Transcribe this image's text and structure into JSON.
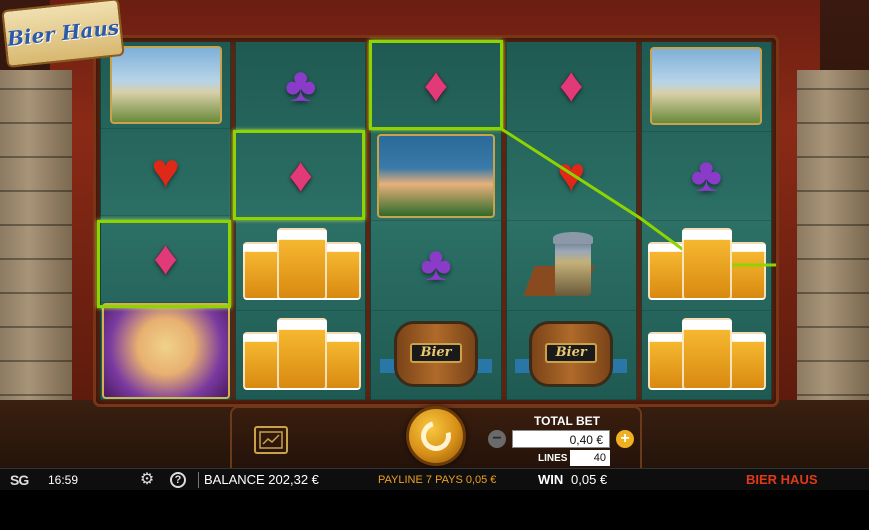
{
  "game": {
    "logo_text": "Bier Haus",
    "title": "BIER HAUS"
  },
  "reels": [
    [
      {
        "symbol": "castle",
        "icon": "castle-picture"
      },
      {
        "symbol": "heart",
        "glyph": "♥"
      },
      {
        "symbol": "diamond",
        "glyph": "♦",
        "winning": true
      },
      {
        "symbol": "woman",
        "icon": "barmaid-picture"
      }
    ],
    [
      {
        "symbol": "club",
        "glyph": "♣"
      },
      {
        "symbol": "diamond",
        "glyph": "♦",
        "winning": true
      },
      {
        "symbol": "beer",
        "icon": "beer-mugs-picture"
      },
      {
        "symbol": "beer",
        "icon": "beer-mugs-picture"
      }
    ],
    [
      {
        "symbol": "diamond",
        "glyph": "♦",
        "winning": true
      },
      {
        "symbol": "man",
        "icon": "bavarian-man-picture"
      },
      {
        "symbol": "club",
        "glyph": "♣"
      },
      {
        "symbol": "barrel",
        "icon": "bier-barrel-picture",
        "label": "Bier"
      }
    ],
    [
      {
        "symbol": "diamond",
        "glyph": "♦"
      },
      {
        "symbol": "heart",
        "glyph": "♥"
      },
      {
        "symbol": "stein",
        "icon": "beer-stein-picture"
      },
      {
        "symbol": "barrel",
        "icon": "bier-barrel-picture",
        "label": "Bier"
      }
    ],
    [
      {
        "symbol": "castle",
        "icon": "castle-picture"
      },
      {
        "symbol": "club",
        "glyph": "♣"
      },
      {
        "symbol": "beer",
        "icon": "beer-mugs-picture"
      },
      {
        "symbol": "beer",
        "icon": "beer-mugs-picture"
      }
    ]
  ],
  "controls": {
    "total_bet_label": "TOTAL BET",
    "total_bet_value": "0,40 €",
    "lines_label": "LINES",
    "lines_value": "40",
    "minus_glyph": "−",
    "plus_glyph": "+"
  },
  "status": {
    "brand": "SG",
    "time": "16:59",
    "settings_glyph": "⚙",
    "help_glyph": "?",
    "balance": "BALANCE 202,32 €",
    "payline_info": "PAYLINE 7 PAYS 0,05 €",
    "win_label": "WIN",
    "win_value": "0,05 €"
  },
  "colors": {
    "payline": "#8ed400",
    "accent": "#f0a020",
    "title": "#e03a1a"
  }
}
